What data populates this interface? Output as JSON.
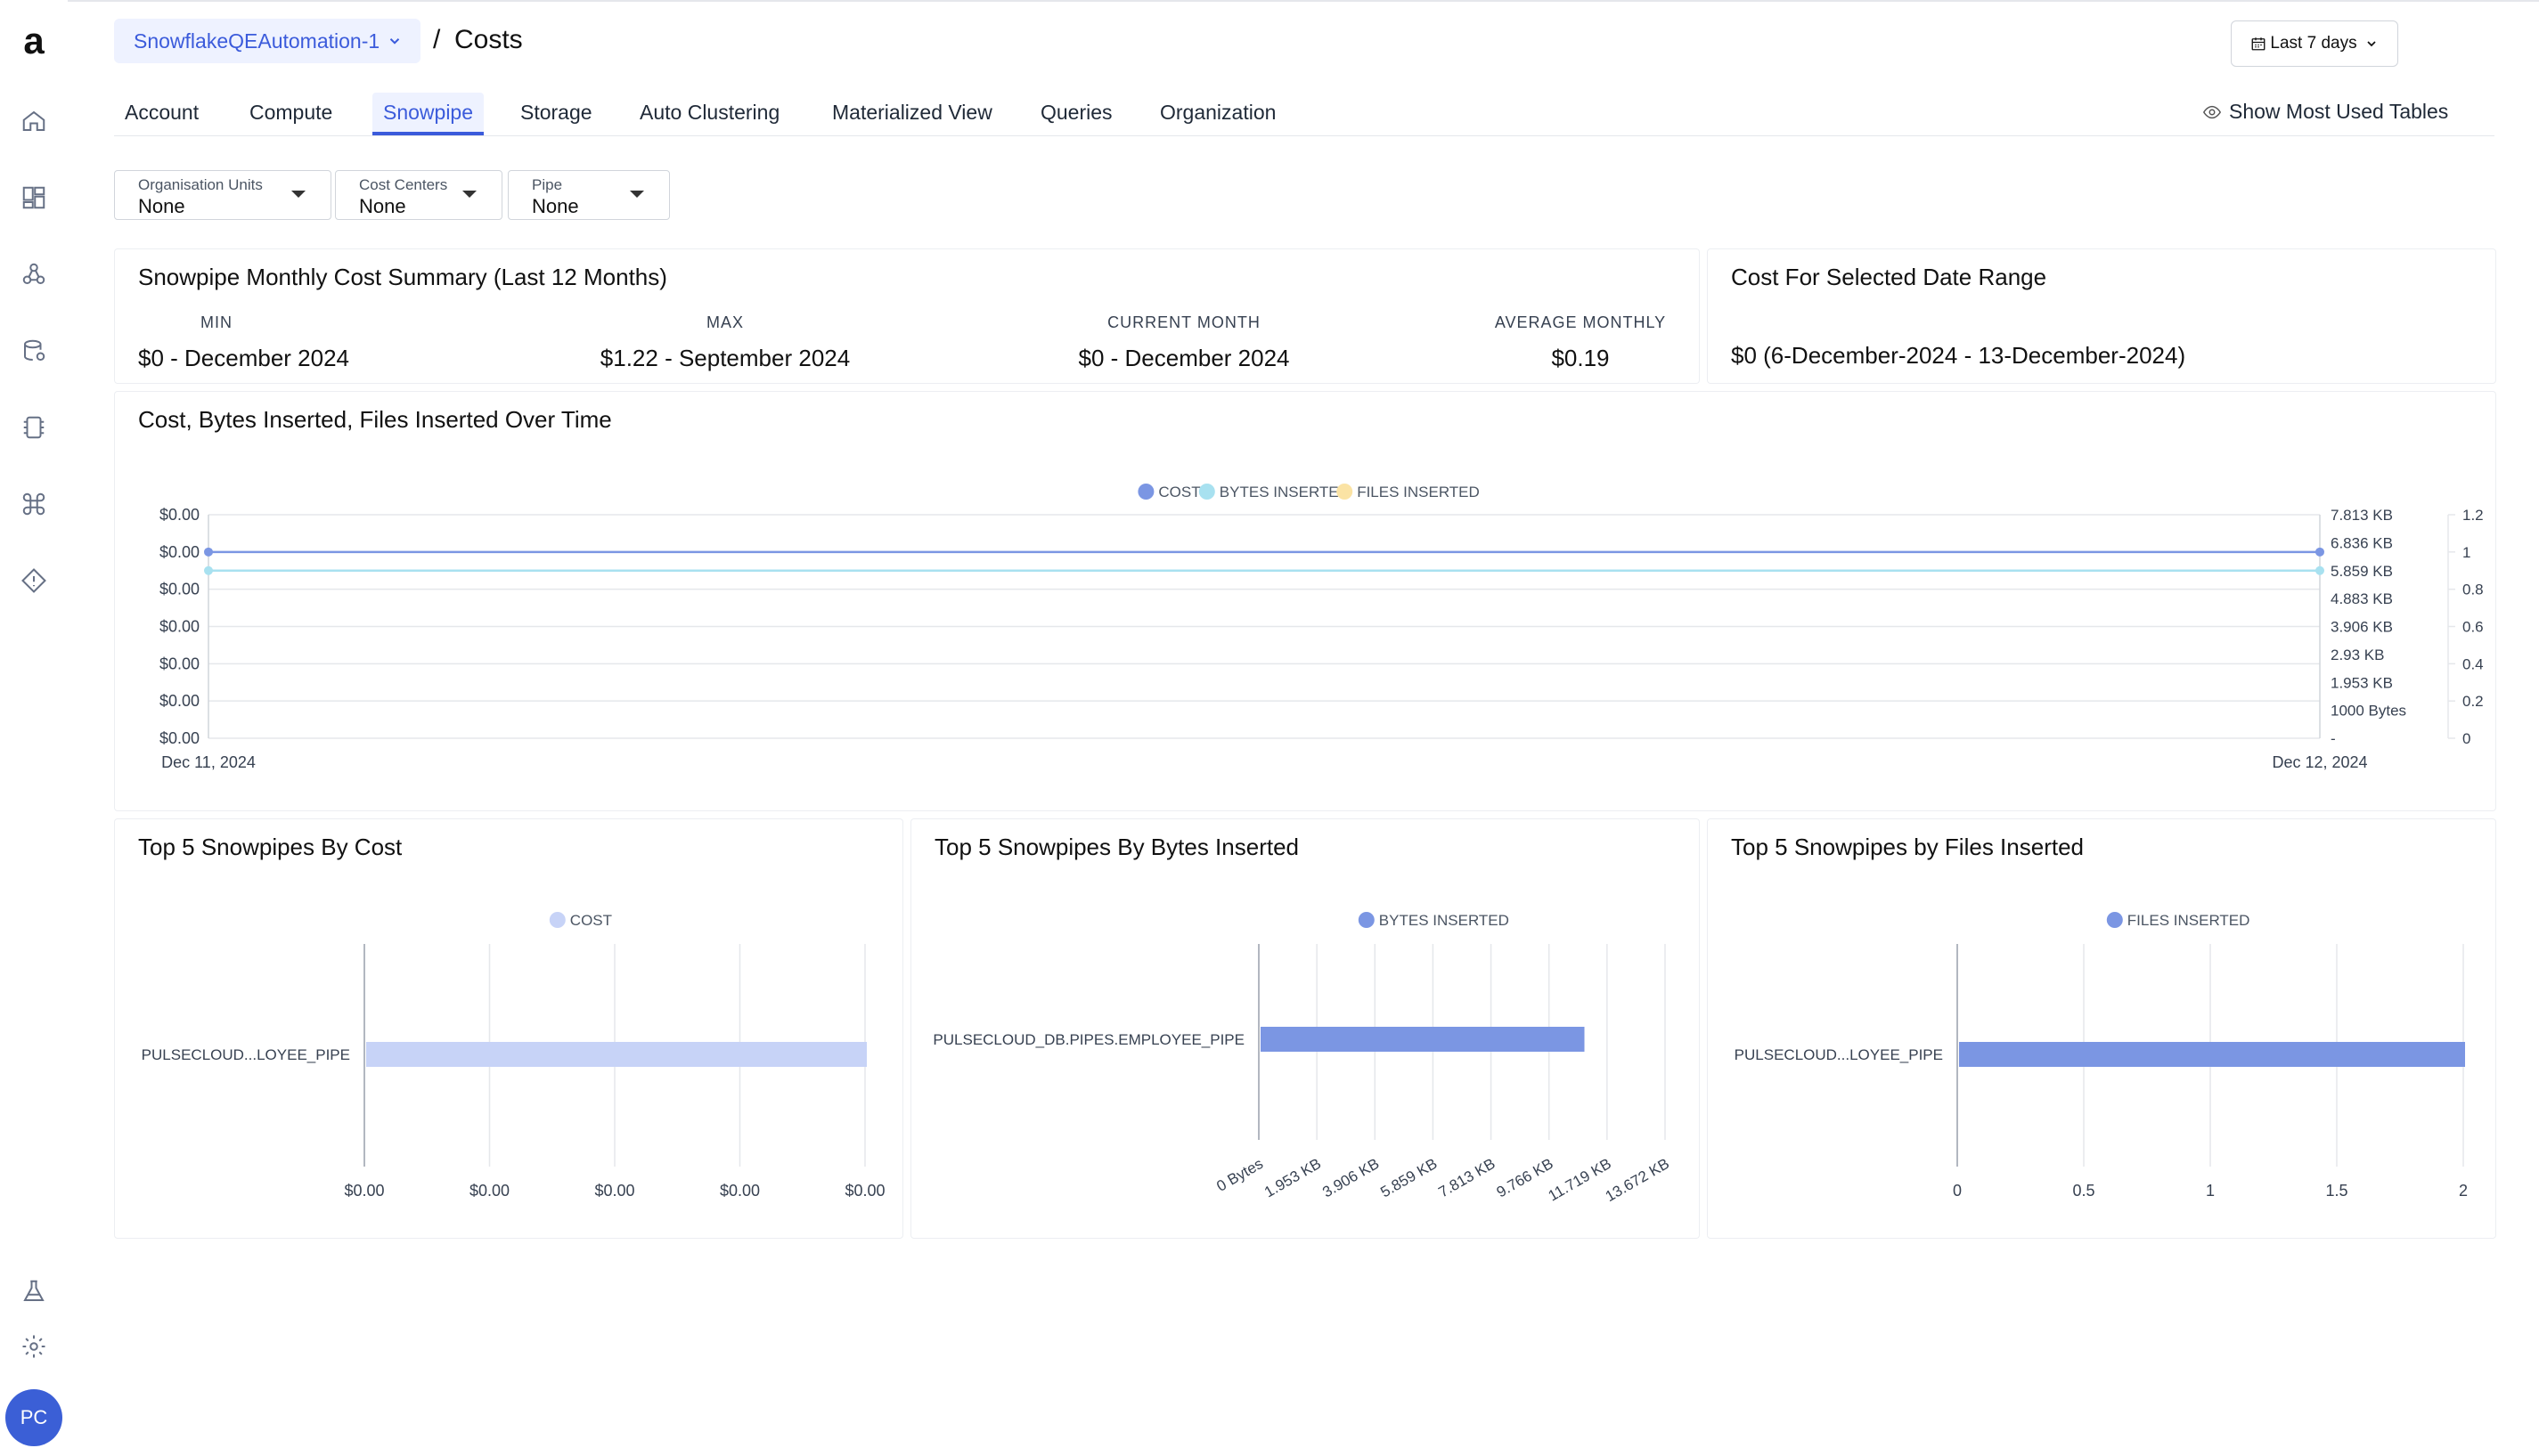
{
  "app": {
    "logo_letter": "a",
    "avatar_initials": "PC"
  },
  "header": {
    "workspace": "SnowflakeQEAutomation-1",
    "separator": "/",
    "title": "Costs",
    "date_range": "Last 7 days"
  },
  "tabs": [
    {
      "label": "Account"
    },
    {
      "label": "Compute"
    },
    {
      "label": "Snowpipe",
      "active": true
    },
    {
      "label": "Storage"
    },
    {
      "label": "Auto Clustering"
    },
    {
      "label": "Materialized View"
    },
    {
      "label": "Queries"
    },
    {
      "label": "Organization"
    }
  ],
  "show_most_used": "Show Most Used Tables",
  "filters": [
    {
      "label": "Organisation Units",
      "value": "None"
    },
    {
      "label": "Cost Centers",
      "value": "None"
    },
    {
      "label": "Pipe",
      "value": "None"
    }
  ],
  "summary": {
    "title": "Snowpipe Monthly Cost Summary (Last 12 Months)",
    "stats": [
      {
        "label": "MIN",
        "value": "$0 - December 2024"
      },
      {
        "label": "MAX",
        "value": "$1.22 - September 2024"
      },
      {
        "label": "CURRENT MONTH",
        "value": "$0 - December 2024"
      },
      {
        "label": "AVERAGE MONTHLY",
        "value": "$0.19"
      }
    ]
  },
  "date_range_card": {
    "title": "Cost For Selected Date Range",
    "value": "$0 (6-December-2024 - 13-December-2024)"
  },
  "colors": {
    "cost": "#7b96e3",
    "bytes": "#a8e1f0",
    "files": "#fbe3a4",
    "cost_light": "#c7d3f7",
    "accent": "#3b5bdb",
    "grid": "#e5e7eb"
  },
  "chart_data": [
    {
      "type": "line",
      "title": "Cost, Bytes Inserted, Files Inserted Over Time",
      "legend_position": "top",
      "x": [
        "Dec 11, 2024",
        "Dec 12, 2024"
      ],
      "series": [
        {
          "name": "COST",
          "axis": "left",
          "values": [
            0,
            0
          ]
        },
        {
          "name": "BYTES INSERTED",
          "axis": "right",
          "values": [
            "5.859 KB",
            "5.859 KB"
          ]
        },
        {
          "name": "FILES INSERTED",
          "axis": "right2",
          "values": [
            1,
            1
          ]
        }
      ],
      "y_left_ticks": [
        "$0.00",
        "$0.00",
        "$0.00",
        "$0.00",
        "$0.00",
        "$0.00",
        "$0.00"
      ],
      "y_right_ticks": [
        "7.813 KB",
        "6.836 KB",
        "5.859 KB",
        "4.883 KB",
        "3.906 KB",
        "2.93 KB",
        "1.953 KB",
        "1000 Bytes",
        "-"
      ],
      "y_right2_ticks": [
        "1.2",
        "1",
        "0.8",
        "0.6",
        "0.4",
        "0.2",
        "0"
      ],
      "grid": true
    },
    {
      "type": "bar",
      "orientation": "horizontal",
      "title": "Top 5 Snowpipes By Cost",
      "legend_position": "top",
      "categories": [
        "PULSECLOUD...LOYEE_PIPE"
      ],
      "series": [
        {
          "name": "COST",
          "values": [
            0
          ]
        }
      ],
      "x_ticks": [
        "$0.00",
        "$0.00",
        "$0.00",
        "$0.00",
        "$0.00"
      ],
      "grid": true
    },
    {
      "type": "bar",
      "orientation": "horizontal",
      "title": "Top 5 Snowpipes By Bytes Inserted",
      "legend_position": "top",
      "categories": [
        "PULSECLOUD_DB.PIPES.EMPLOYEE_PIPE"
      ],
      "series": [
        {
          "name": "BYTES INSERTED",
          "values": [
            12
          ]
        }
      ],
      "x_ticks": [
        "0 Bytes",
        "1.953 KB",
        "3.906 KB",
        "5.859 KB",
        "7.813 KB",
        "9.766 KB",
        "11.719 KB",
        "13.672 KB"
      ],
      "xlim": [
        0,
        14
      ],
      "grid": true
    },
    {
      "type": "bar",
      "orientation": "horizontal",
      "title": "Top 5 Snowpipes by Files Inserted",
      "legend_position": "top",
      "categories": [
        "PULSECLOUD...LOYEE_PIPE"
      ],
      "series": [
        {
          "name": "FILES INSERTED",
          "values": [
            2
          ]
        }
      ],
      "x_ticks": [
        "0",
        "0.5",
        "1",
        "1.5",
        "2"
      ],
      "xlim": [
        0,
        2
      ],
      "grid": true
    }
  ]
}
